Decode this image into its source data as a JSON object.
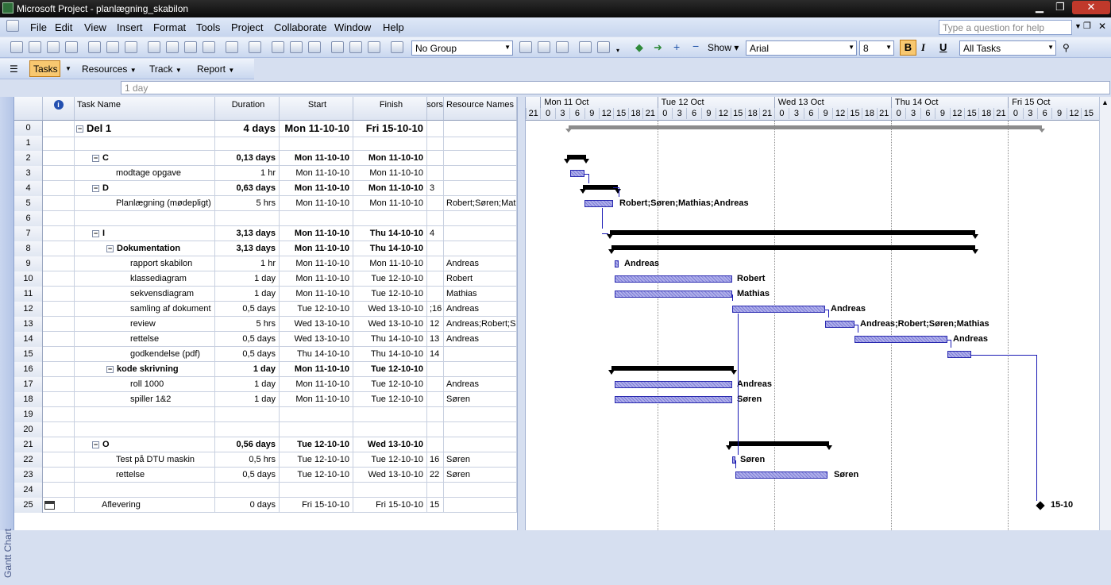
{
  "window": {
    "title": "Microsoft Project - planlægning_skabilon"
  },
  "menu": {
    "items": [
      "File",
      "Edit",
      "View",
      "Insert",
      "Format",
      "Tools",
      "Project",
      "Collaborate",
      "Window",
      "Help"
    ],
    "help_placeholder": "Type a question for help"
  },
  "toolbar": {
    "group": "No Group",
    "show": "Show",
    "font": "Arial",
    "size": "8",
    "bold": "B",
    "italic": "I",
    "underline": "U",
    "filter": "All Tasks"
  },
  "guide": {
    "tasks": "Tasks",
    "resources": "Resources",
    "track": "Track",
    "report": "Report"
  },
  "entry_value": "1 day",
  "view_label": "Gantt Chart",
  "columns": {
    "info": "i",
    "name": "Task Name",
    "duration": "Duration",
    "start": "Start",
    "finish": "Finish",
    "pred": "ecessors",
    "res": "Resource Names"
  },
  "rows": [
    {
      "id": "0",
      "name": "Del 1",
      "dur": "4 days",
      "start": "Mon 11-10-10",
      "fin": "Fri 15-10-10",
      "pred": "",
      "res": ""
    },
    {
      "id": "1",
      "name": "",
      "dur": "",
      "start": "",
      "fin": "",
      "pred": "",
      "res": ""
    },
    {
      "id": "2",
      "name": "C",
      "dur": "0,13 days",
      "start": "Mon 11-10-10",
      "fin": "Mon 11-10-10",
      "pred": "",
      "res": ""
    },
    {
      "id": "3",
      "name": "modtage opgave",
      "dur": "1 hr",
      "start": "Mon 11-10-10",
      "fin": "Mon 11-10-10",
      "pred": "",
      "res": ""
    },
    {
      "id": "4",
      "name": "D",
      "dur": "0,63 days",
      "start": "Mon 11-10-10",
      "fin": "Mon 11-10-10",
      "pred": "3",
      "res": ""
    },
    {
      "id": "5",
      "name": "Planlægning (mødepligt)",
      "dur": "5 hrs",
      "start": "Mon 11-10-10",
      "fin": "Mon 11-10-10",
      "pred": "",
      "res": "Robert;Søren;Mathias;Andreas"
    },
    {
      "id": "6",
      "name": "",
      "dur": "",
      "start": "",
      "fin": "",
      "pred": "",
      "res": ""
    },
    {
      "id": "7",
      "name": "I",
      "dur": "3,13 days",
      "start": "Mon 11-10-10",
      "fin": "Thu 14-10-10",
      "pred": "4",
      "res": ""
    },
    {
      "id": "8",
      "name": "Dokumentation",
      "dur": "3,13 days",
      "start": "Mon 11-10-10",
      "fin": "Thu 14-10-10",
      "pred": "",
      "res": ""
    },
    {
      "id": "9",
      "name": "rapport skabilon",
      "dur": "1 hr",
      "start": "Mon 11-10-10",
      "fin": "Mon 11-10-10",
      "pred": "",
      "res": "Andreas"
    },
    {
      "id": "10",
      "name": "klassediagram",
      "dur": "1 day",
      "start": "Mon 11-10-10",
      "fin": "Tue 12-10-10",
      "pred": "",
      "res": "Robert"
    },
    {
      "id": "11",
      "name": "sekvensdiagram",
      "dur": "1 day",
      "start": "Mon 11-10-10",
      "fin": "Tue 12-10-10",
      "pred": "",
      "res": "Mathias"
    },
    {
      "id": "12",
      "name": "samling af dokument",
      "dur": "0,5 days",
      "start": "Tue 12-10-10",
      "fin": "Wed 13-10-10",
      "pred": ";16",
      "res": "Andreas"
    },
    {
      "id": "13",
      "name": "review",
      "dur": "5 hrs",
      "start": "Wed 13-10-10",
      "fin": "Wed 13-10-10",
      "pred": "12",
      "res": "Andreas;Robert;Søren;Mathias"
    },
    {
      "id": "14",
      "name": "rettelse",
      "dur": "0,5 days",
      "start": "Wed 13-10-10",
      "fin": "Thu 14-10-10",
      "pred": "13",
      "res": "Andreas"
    },
    {
      "id": "15",
      "name": "godkendelse (pdf)",
      "dur": "0,5 days",
      "start": "Thu 14-10-10",
      "fin": "Thu 14-10-10",
      "pred": "14",
      "res": ""
    },
    {
      "id": "16",
      "name": "kode skrivning",
      "dur": "1 day",
      "start": "Mon 11-10-10",
      "fin": "Tue 12-10-10",
      "pred": "",
      "res": ""
    },
    {
      "id": "17",
      "name": "roll 1000",
      "dur": "1 day",
      "start": "Mon 11-10-10",
      "fin": "Tue 12-10-10",
      "pred": "",
      "res": "Andreas"
    },
    {
      "id": "18",
      "name": "spiller 1&2",
      "dur": "1 day",
      "start": "Mon 11-10-10",
      "fin": "Tue 12-10-10",
      "pred": "",
      "res": "Søren"
    },
    {
      "id": "19",
      "name": "",
      "dur": "",
      "start": "",
      "fin": "",
      "pred": "",
      "res": ""
    },
    {
      "id": "20",
      "name": "",
      "dur": "",
      "start": "",
      "fin": "",
      "pred": "",
      "res": ""
    },
    {
      "id": "21",
      "name": "O",
      "dur": "0,56 days",
      "start": "Tue 12-10-10",
      "fin": "Wed 13-10-10",
      "pred": "",
      "res": ""
    },
    {
      "id": "22",
      "name": "Test på DTU maskin",
      "dur": "0,5 hrs",
      "start": "Tue 12-10-10",
      "fin": "Tue 12-10-10",
      "pred": "16",
      "res": "Søren"
    },
    {
      "id": "23",
      "name": "rettelse",
      "dur": "0,5 days",
      "start": "Tue 12-10-10",
      "fin": "Wed 13-10-10",
      "pred": "22",
      "res": "Søren"
    },
    {
      "id": "24",
      "name": "",
      "dur": "",
      "start": "",
      "fin": "",
      "pred": "",
      "res": ""
    },
    {
      "id": "25",
      "name": "Aflevering",
      "dur": "0 days",
      "start": "Fri 15-10-10",
      "fin": "Fri 15-10-10",
      "pred": "15",
      "res": ""
    }
  ],
  "timescale": {
    "days": [
      "Mon 11 Oct",
      "Tue 12 Oct",
      "Wed 13 Oct",
      "Thu 14 Oct",
      "Fri 15 Oct"
    ],
    "hours": [
      "21",
      "0",
      "3",
      "6",
      "9",
      "12",
      "15",
      "18",
      "21",
      "0",
      "3",
      "6",
      "9",
      "12",
      "15",
      "18",
      "21",
      "0",
      "3",
      "6",
      "9",
      "12",
      "15",
      "18",
      "21",
      "0",
      "3",
      "6",
      "9",
      "12",
      "15",
      "18",
      "21",
      "0",
      "3",
      "6",
      "9",
      "12",
      "15"
    ]
  },
  "gantt_labels": {
    "r5": "Robert;Søren;Mathias;Andreas",
    "r9": "Andreas",
    "r10": "Robert",
    "r11": "Mathias",
    "r12": "Andreas",
    "r13": "Andreas;Robert;Søren;Mathias",
    "r14": "Andreas",
    "r17": "Andreas",
    "r18": "Søren",
    "r22": "Søren",
    "r23": "Søren",
    "r25": "15-10"
  }
}
